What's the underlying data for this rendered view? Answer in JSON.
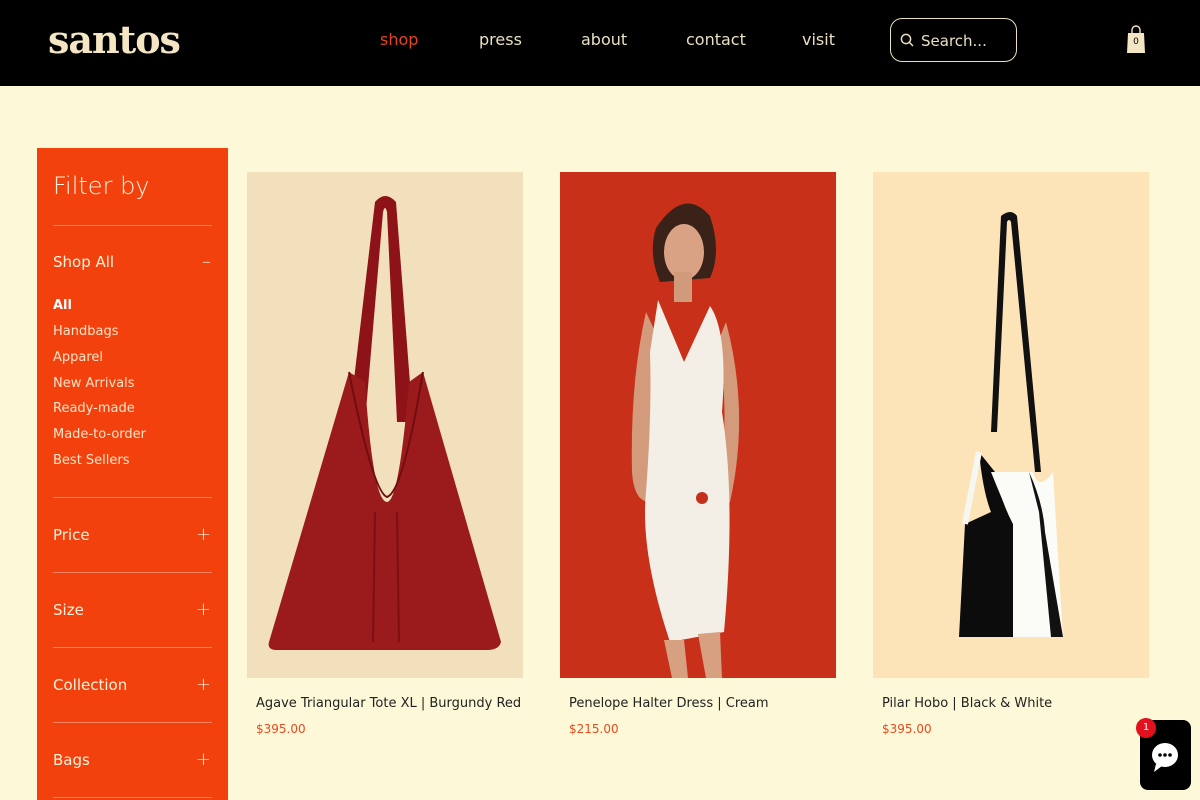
{
  "brand": {
    "logo": "santos"
  },
  "nav": {
    "items": [
      {
        "label": "shop",
        "active": true
      },
      {
        "label": "press"
      },
      {
        "label": "about"
      },
      {
        "label": "contact"
      },
      {
        "label": "visit"
      }
    ]
  },
  "search": {
    "placeholder": "Search..."
  },
  "cart": {
    "count": "0"
  },
  "sidebar": {
    "title": "Filter by",
    "shop_all": {
      "label": "Shop All",
      "toggle": "–",
      "items": [
        "All",
        "Handbags",
        "Apparel",
        "New Arrivals",
        "Ready-made",
        "Made-to-order",
        "Best Sellers"
      ]
    },
    "sections": [
      {
        "label": "Price",
        "toggle": "+"
      },
      {
        "label": "Size",
        "toggle": "+"
      },
      {
        "label": "Collection",
        "toggle": "+"
      },
      {
        "label": "Bags",
        "toggle": "+"
      }
    ]
  },
  "products": [
    {
      "name": "Agave Triangular Tote XL | Burgundy Red",
      "price": "$395.00"
    },
    {
      "name": "Penelope Halter Dress | Cream",
      "price": "$215.00"
    },
    {
      "name": "Pilar Hobo | Black & White",
      "price": "$395.00"
    }
  ],
  "chat": {
    "badge": "1"
  },
  "colors": {
    "accent": "#f2410d",
    "background": "#fdf8d8",
    "header": "#000000",
    "price": "#e84a1f"
  }
}
